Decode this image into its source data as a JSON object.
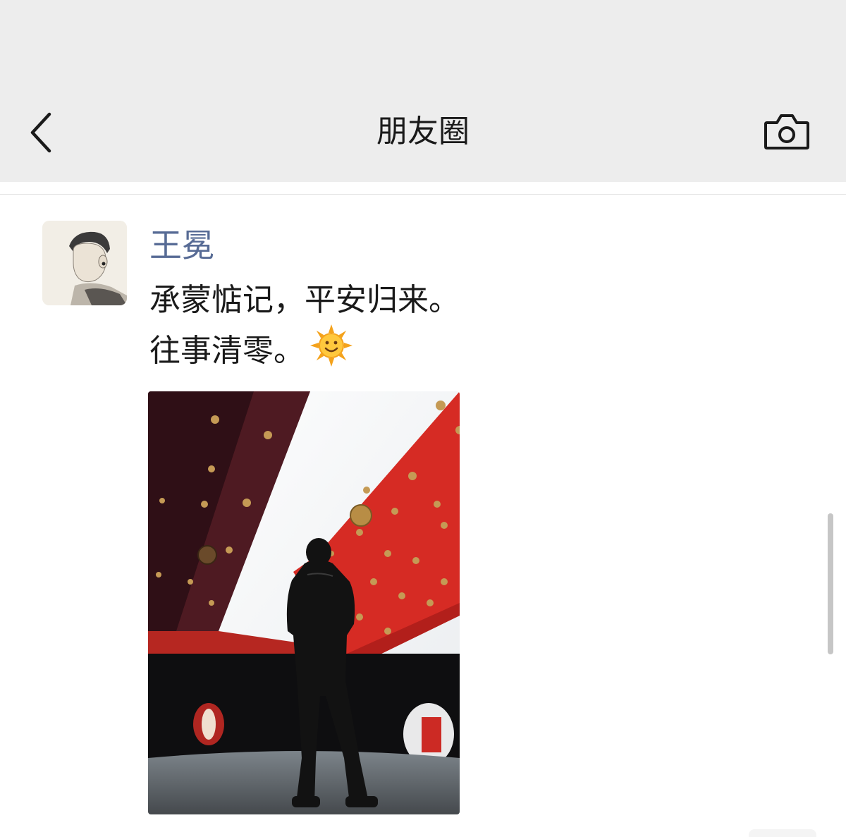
{
  "nav": {
    "title": "朋友圈",
    "back_icon": "chevron-left-icon",
    "camera_icon": "camera-icon"
  },
  "post": {
    "author": "王冕",
    "lines": [
      "承蒙惦记，平安归来。",
      "往事清零。"
    ],
    "emoji_icon": "smiling-sun-icon",
    "photo_icon": "photo-man-under-red-gate"
  },
  "colors": {
    "nav_bg": "#ededed",
    "author_link": "#576b95",
    "text": "#1a1a1a",
    "gate_red": "#d62b24"
  }
}
